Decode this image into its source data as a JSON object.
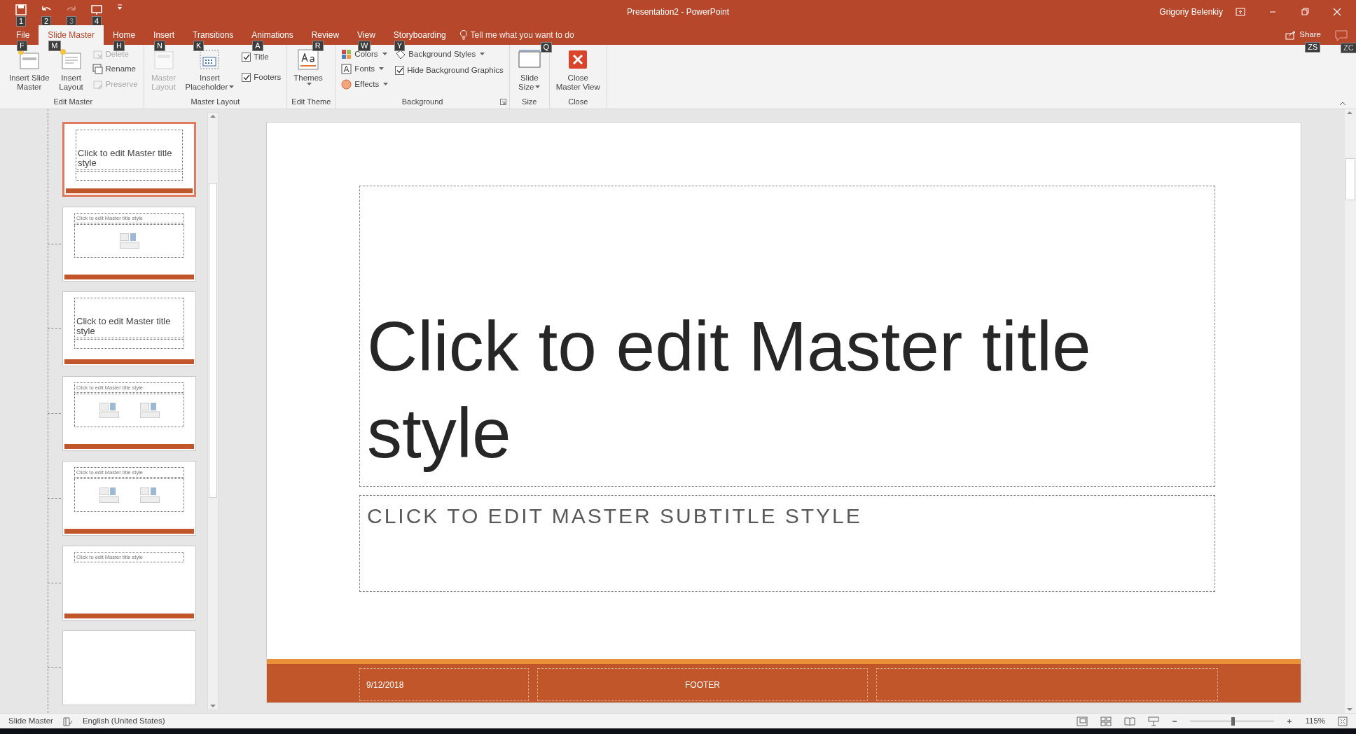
{
  "window": {
    "title": "Presentation2  -  PowerPoint",
    "user": "Grigoriy Belenkiy"
  },
  "quick_access": [
    {
      "keytip": "1",
      "disabled": false
    },
    {
      "keytip": "2",
      "disabled": false
    },
    {
      "keytip": "3",
      "disabled": true
    },
    {
      "keytip": "4",
      "disabled": false
    }
  ],
  "tabs": [
    {
      "label": "File",
      "keytip": "F",
      "selected": false
    },
    {
      "label": "Slide Master",
      "keytip": "M",
      "selected": true
    },
    {
      "label": "Home",
      "keytip": "H",
      "selected": false
    },
    {
      "label": "Insert",
      "keytip": "N",
      "selected": false
    },
    {
      "label": "Transitions",
      "keytip": "K",
      "selected": false
    },
    {
      "label": "Animations",
      "keytip": "A",
      "selected": false
    },
    {
      "label": "Review",
      "keytip": "R",
      "selected": false
    },
    {
      "label": "View",
      "keytip": "W",
      "selected": false
    },
    {
      "label": "Storyboarding",
      "keytip": "Y",
      "selected": false
    }
  ],
  "tell_me": {
    "placeholder": "Tell me what you want to do",
    "keytip": "Q"
  },
  "share": {
    "label": "Share",
    "keytip": "ZS"
  },
  "comments": {
    "keytip": "ZC"
  },
  "ribbon_groups": [
    {
      "label": "Edit Master",
      "columns": [
        [
          {
            "kind": "large",
            "label": "Insert Slide\nMaster",
            "disabled": false
          }
        ],
        [
          {
            "kind": "large",
            "label": "Insert\nLayout",
            "disabled": false
          }
        ],
        [
          {
            "kind": "small",
            "label": "Delete",
            "disabled": true
          },
          {
            "kind": "small",
            "label": "Rename",
            "disabled": false
          },
          {
            "kind": "small",
            "label": "Preserve",
            "disabled": true
          }
        ]
      ]
    },
    {
      "label": "Master Layout",
      "columns": [
        [
          {
            "kind": "large",
            "label": "Master\nLayout",
            "disabled": true
          }
        ],
        [
          {
            "kind": "large",
            "label": "Insert\nPlaceholder",
            "disabled": false,
            "dropdown": true
          }
        ],
        [
          {
            "kind": "check",
            "label": "Title",
            "checked": true
          },
          {
            "kind": "check",
            "label": "Footers",
            "checked": true
          }
        ]
      ]
    },
    {
      "label": "Edit Theme",
      "columns": [
        [
          {
            "kind": "large",
            "label": "Themes",
            "disabled": false,
            "dropdown": true
          }
        ]
      ]
    },
    {
      "label": "Background",
      "launcher": true,
      "columns": [
        [
          {
            "kind": "small",
            "label": "Colors",
            "disabled": false,
            "dropdown": true
          },
          {
            "kind": "small",
            "label": "Fonts",
            "disabled": false,
            "dropdown": true
          },
          {
            "kind": "small",
            "label": "Effects",
            "disabled": false,
            "dropdown": true
          }
        ],
        [
          {
            "kind": "small",
            "label": "Background Styles",
            "disabled": false,
            "dropdown": true
          },
          {
            "kind": "check",
            "label": "Hide Background Graphics",
            "checked": true
          }
        ]
      ]
    },
    {
      "label": "Size",
      "columns": [
        [
          {
            "kind": "large",
            "label": "Slide\nSize",
            "disabled": false,
            "dropdown": true
          }
        ]
      ]
    },
    {
      "label": "Close",
      "columns": [
        [
          {
            "kind": "large",
            "label": "Close\nMaster View",
            "disabled": false
          }
        ]
      ]
    }
  ],
  "thumbnails": [
    {
      "kind": "title",
      "title": "Click to edit Master title style",
      "selected": true
    },
    {
      "kind": "content",
      "title": "Click to edit Master title style",
      "selected": false
    },
    {
      "kind": "title",
      "title": "Click to edit Master title style",
      "selected": false
    },
    {
      "kind": "two-content",
      "title": "Click to edit Master title style",
      "selected": false
    },
    {
      "kind": "two-content",
      "title": "Click to edit Master title style",
      "selected": false
    },
    {
      "kind": "title-only",
      "title": "Click to edit Master title style",
      "selected": false
    },
    {
      "kind": "blank",
      "selected": false
    }
  ],
  "slide": {
    "title": "Click to edit Master title style",
    "subtitle": "CLICK TO EDIT MASTER SUBTITLE STYLE",
    "date": "9/12/2018",
    "footer": "FOOTER"
  },
  "status_bar": {
    "mode": "Slide Master",
    "language": "English (United States)",
    "zoom": "115%",
    "zoom_slider": {
      "level": 0.49
    }
  }
}
